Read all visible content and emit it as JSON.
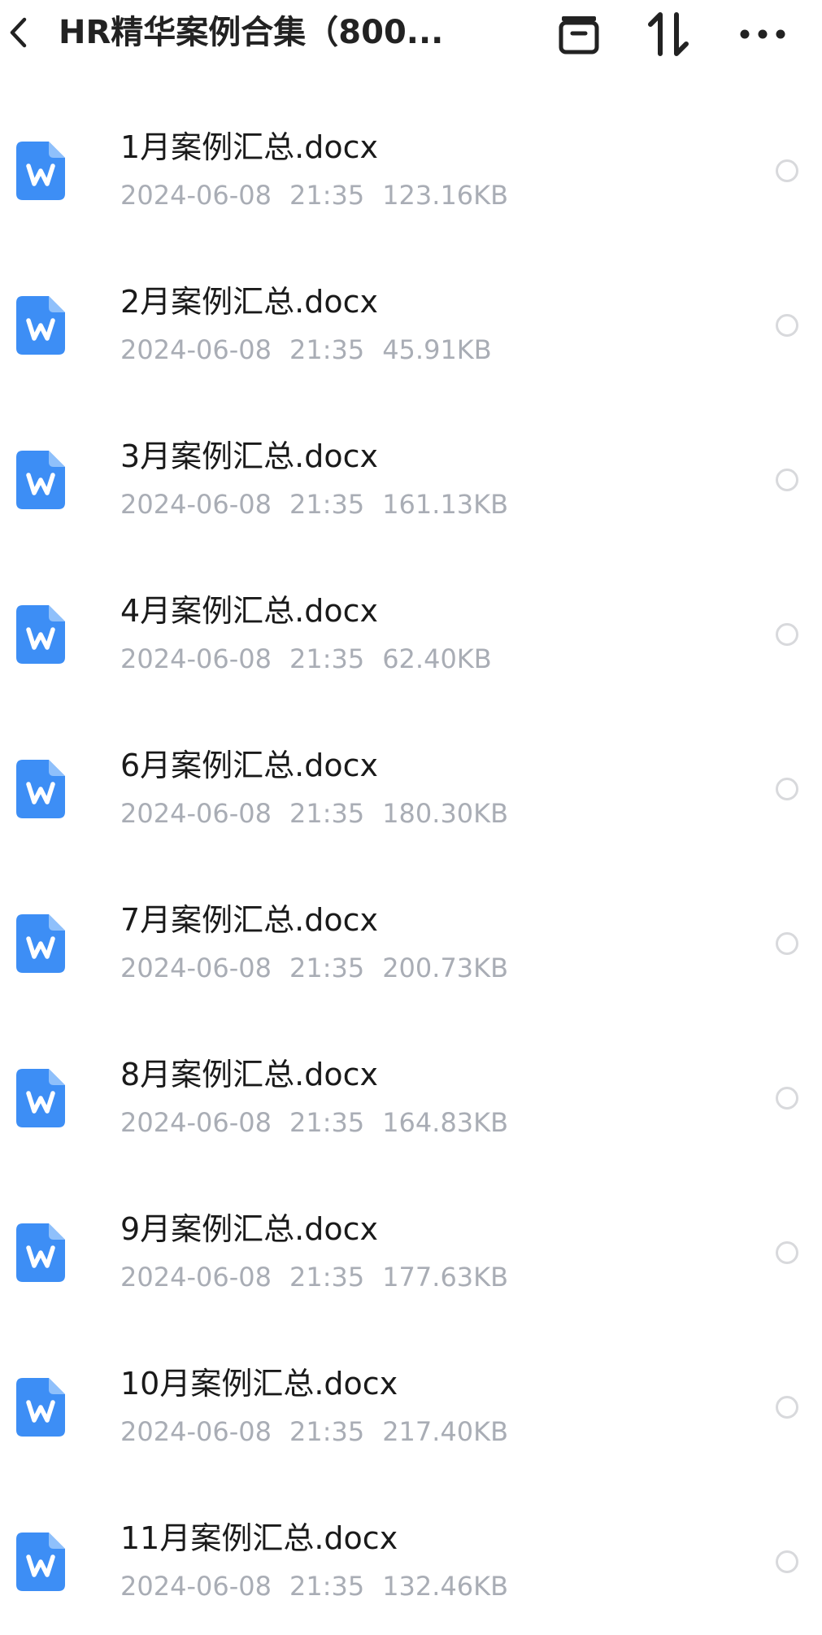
{
  "header": {
    "title": "HR精华案例合集（800...",
    "back_icon": "chevron-left-icon",
    "archive_icon": "archive-box-icon",
    "sort_icon": "sort-arrows-icon",
    "more_icon": "more-horizontal-icon"
  },
  "colors": {
    "file_icon_blue": "#3d8ef5",
    "meta_gray": "#a9adb5",
    "radio_border": "#d8d9dc"
  },
  "files": [
    {
      "name": "1月案例汇总.docx",
      "date": "2024-06-08",
      "time": "21:35",
      "size": "123.16KB",
      "icon": "word-doc-icon"
    },
    {
      "name": "2月案例汇总.docx",
      "date": "2024-06-08",
      "time": "21:35",
      "size": "45.91KB",
      "icon": "word-doc-icon"
    },
    {
      "name": "3月案例汇总.docx",
      "date": "2024-06-08",
      "time": "21:35",
      "size": "161.13KB",
      "icon": "word-doc-icon"
    },
    {
      "name": "4月案例汇总.docx",
      "date": "2024-06-08",
      "time": "21:35",
      "size": "62.40KB",
      "icon": "word-doc-icon"
    },
    {
      "name": "6月案例汇总.docx",
      "date": "2024-06-08",
      "time": "21:35",
      "size": "180.30KB",
      "icon": "word-doc-icon"
    },
    {
      "name": "7月案例汇总.docx",
      "date": "2024-06-08",
      "time": "21:35",
      "size": "200.73KB",
      "icon": "word-doc-icon"
    },
    {
      "name": "8月案例汇总.docx",
      "date": "2024-06-08",
      "time": "21:35",
      "size": "164.83KB",
      "icon": "word-doc-icon"
    },
    {
      "name": "9月案例汇总.docx",
      "date": "2024-06-08",
      "time": "21:35",
      "size": "177.63KB",
      "icon": "word-doc-icon"
    },
    {
      "name": "10月案例汇总.docx",
      "date": "2024-06-08",
      "time": "21:35",
      "size": "217.40KB",
      "icon": "word-doc-icon"
    },
    {
      "name": "11月案例汇总.docx",
      "date": "2024-06-08",
      "time": "21:35",
      "size": "132.46KB",
      "icon": "word-doc-icon"
    }
  ]
}
